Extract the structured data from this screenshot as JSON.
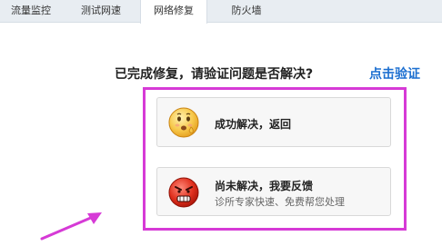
{
  "tabs": [
    {
      "label": "流量监控",
      "active": false
    },
    {
      "label": "测试网速",
      "active": false
    },
    {
      "label": "网络修复",
      "active": true
    },
    {
      "label": "防火墙",
      "active": false
    }
  ],
  "main": {
    "question": "已完成修复，请验证问题是否解决?",
    "verify_link": "点击验证"
  },
  "options": {
    "resolved": {
      "title": "成功解决，返回",
      "icon": "happy-face-icon"
    },
    "unresolved": {
      "title": "尚未解决，我要反馈",
      "subtitle": "诊所专家快速、免费帮您处理",
      "icon": "angry-face-icon"
    }
  },
  "colors": {
    "highlight": "#d63ad6",
    "link": "#1c6fd0",
    "arrow": "#d63ad6"
  }
}
